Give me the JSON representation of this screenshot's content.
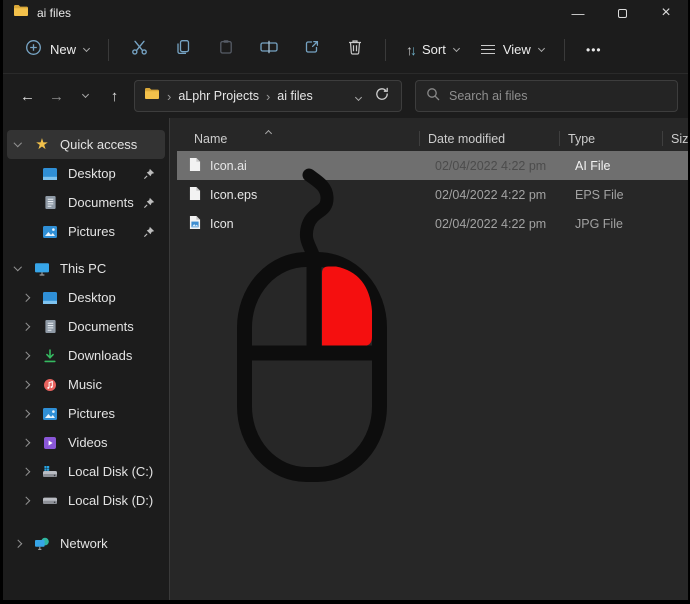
{
  "window": {
    "title": "ai files",
    "controls": {
      "minimize": "—",
      "maximize": "maximize",
      "close": "×"
    }
  },
  "toolbar": {
    "new_label": "New",
    "sort_label": "Sort",
    "view_label": "View",
    "more_label": "•••",
    "icons": [
      "cut",
      "copy",
      "paste",
      "rename",
      "share",
      "delete"
    ]
  },
  "navigation": {
    "back": "←",
    "forward": "→",
    "up": "↑"
  },
  "breadcrumb": {
    "separator": "›",
    "segments": [
      "aLphr Projects",
      "ai files"
    ]
  },
  "search": {
    "placeholder": "Search ai files"
  },
  "sidebar": {
    "items": [
      {
        "label": "Quick access",
        "icon": "star-icon",
        "level": 0,
        "expanded": true,
        "selected": true
      },
      {
        "label": "Desktop",
        "icon": "desktop-icon",
        "level": 1,
        "pinned": true
      },
      {
        "label": "Documents",
        "icon": "documents-icon",
        "level": 1,
        "pinned": true
      },
      {
        "label": "Pictures",
        "icon": "pictures-icon",
        "level": 1,
        "pinned": true
      },
      {
        "label": "This PC",
        "icon": "this-pc-icon",
        "level": 0,
        "expanded": true
      },
      {
        "label": "Desktop",
        "icon": "desktop-icon",
        "level": 1
      },
      {
        "label": "Documents",
        "icon": "documents-icon",
        "level": 1
      },
      {
        "label": "Downloads",
        "icon": "downloads-icon",
        "level": 1
      },
      {
        "label": "Music",
        "icon": "music-icon",
        "level": 1
      },
      {
        "label": "Pictures",
        "icon": "pictures-icon",
        "level": 1
      },
      {
        "label": "Videos",
        "icon": "videos-icon",
        "level": 1
      },
      {
        "label": "Local Disk (C:)",
        "icon": "disk-icon",
        "level": 1
      },
      {
        "label": "Local Disk (D:)",
        "icon": "disk-icon",
        "level": 1
      },
      {
        "label": "Network",
        "icon": "network-icon",
        "level": 0
      }
    ]
  },
  "files": {
    "columns": {
      "name": "Name",
      "date": "Date modified",
      "type": "Type",
      "size": "Size"
    },
    "sorted_by": "name-ascending",
    "rows": [
      {
        "name": "Icon.ai",
        "date": "02/04/2022 4:22 pm",
        "type": "AI File",
        "selected": true,
        "icon": "file-icon"
      },
      {
        "name": "Icon.eps",
        "date": "02/04/2022 4:22 pm",
        "type": "EPS File",
        "selected": false,
        "icon": "file-icon"
      },
      {
        "name": "Icon",
        "date": "02/04/2022 4:22 pm",
        "type": "JPG File",
        "selected": false,
        "icon": "image-file-icon"
      }
    ]
  },
  "graphic": {
    "description": "hand-drawn computer mouse with right button highlighted (right-click illustration)",
    "outline_color": "#0d0d0d",
    "highlight_color": "#f50f0f"
  },
  "colors": {
    "chrome_bg": "#1c1c1c",
    "content_bg": "#272727",
    "selection_gray": "#6f6f6f",
    "accent_icon_blue": "#76a3c3",
    "folder_yellow": "#f3c14b"
  }
}
